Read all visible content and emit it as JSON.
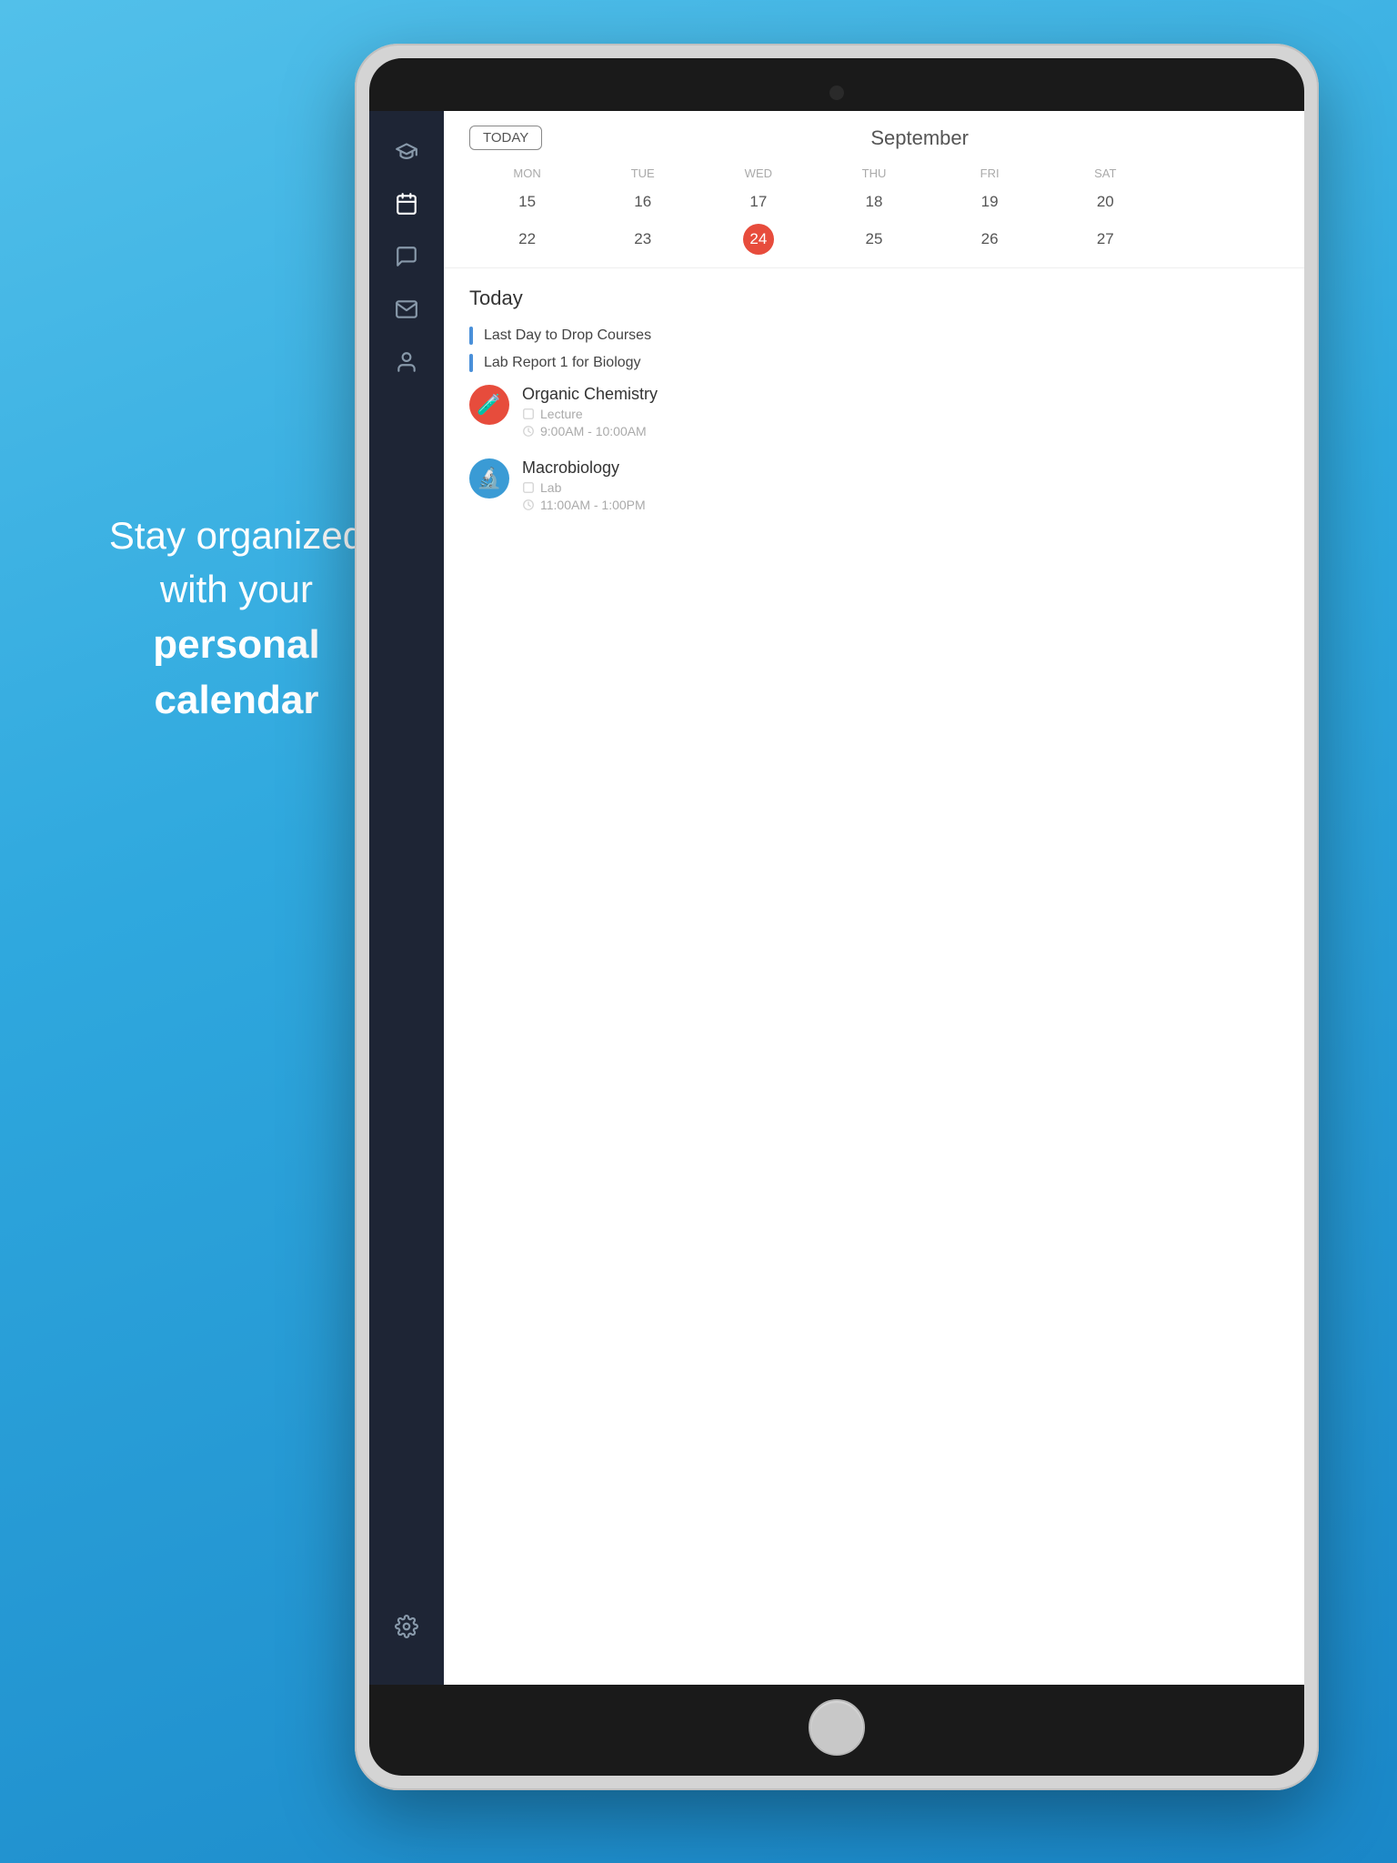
{
  "background": {
    "gradient_start": "#4db8e8",
    "gradient_end": "#1a87c8"
  },
  "tagline": {
    "line1": "Stay organized",
    "line2": "with your",
    "line3": "personal calendar"
  },
  "ipad": {
    "camera_label": "front-camera"
  },
  "sidebar": {
    "icons": [
      {
        "name": "courses-icon",
        "label": "Courses",
        "active": false
      },
      {
        "name": "calendar-icon",
        "label": "Calendar",
        "active": true
      },
      {
        "name": "chat-icon",
        "label": "Chat",
        "active": false
      },
      {
        "name": "mail-icon",
        "label": "Mail",
        "active": false
      },
      {
        "name": "profile-icon",
        "label": "Profile",
        "active": false
      }
    ],
    "settings_icon": "settings-icon"
  },
  "calendar": {
    "today_button": "TODAY",
    "month": "September",
    "days_of_week": [
      "MON",
      "TUE",
      "WED",
      "THU",
      "FRI",
      "SAT"
    ],
    "week1": [
      "15",
      "16",
      "17",
      "18",
      "19",
      "20"
    ],
    "week2": [
      "22",
      "23",
      "24",
      "25",
      "26",
      "27"
    ],
    "today_date": "24"
  },
  "today_section": {
    "heading": "Today",
    "reminders": [
      {
        "text": "Last Day to Drop Courses"
      },
      {
        "text": "Lab Report 1 for Biology"
      }
    ],
    "events": [
      {
        "title": "Organic Chemistry",
        "type": "Lecture",
        "time": "9:00AM - 10:00AM",
        "icon_color": "red",
        "icon_emoji": "🧪"
      },
      {
        "title": "Macrobiology",
        "type": "Lab",
        "time": "11:00AM - 1:00PM",
        "icon_color": "blue",
        "icon_emoji": "🔬"
      }
    ]
  }
}
